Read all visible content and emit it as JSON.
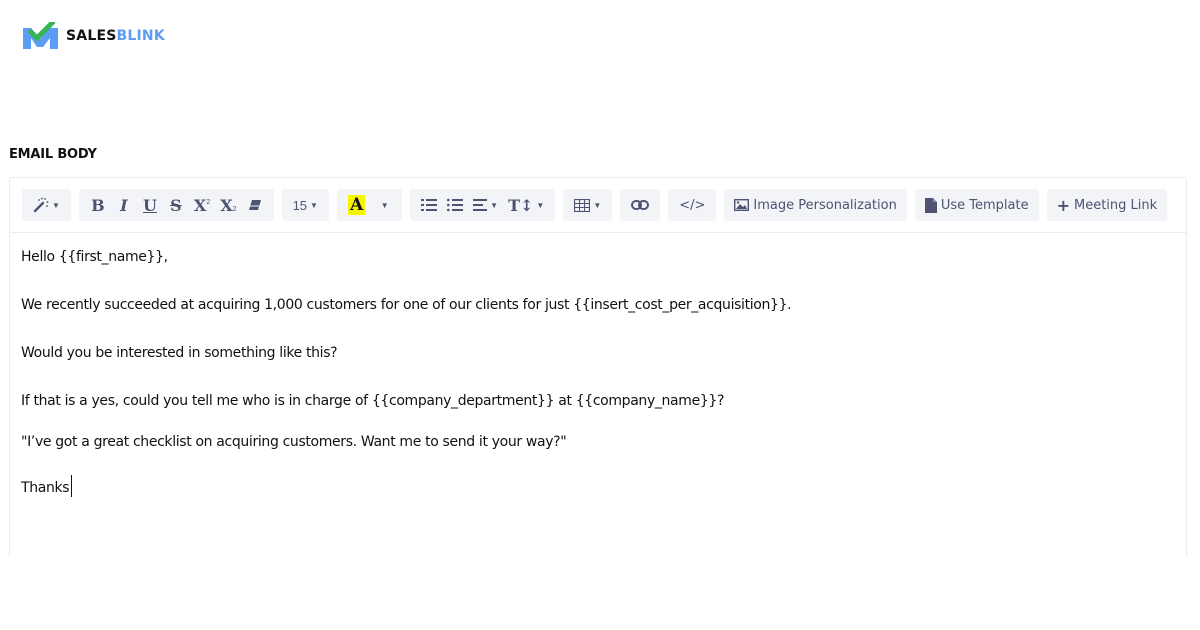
{
  "brand": {
    "name_part1": "SALES",
    "name_part2": "BLINK",
    "accent_color": "#5b9cf5",
    "check_color": "#36b555"
  },
  "section": {
    "title": "EMAIL BODY"
  },
  "toolbar": {
    "magic_icon": "magic-wand-icon",
    "bold": "B",
    "italic": "I",
    "underline": "U",
    "strikethrough": "S",
    "superscript": "X",
    "superscript_mark": "2",
    "subscript": "X",
    "subscript_mark": "2",
    "font_size": "15",
    "highlight_letter": "A",
    "highlight_color": "#f5f500",
    "text_height": "T↕",
    "code": "</>",
    "image_personalization": "Image Personalization",
    "use_template": "Use Template",
    "meeting_link": "Meeting Link",
    "plus": "+"
  },
  "body": {
    "lines": [
      "Hello {{first_name}},",
      "We recently succeeded at acquiring 1,000 customers for one of our clients for just {{insert_cost_per_acquisition}}.",
      "Would you be interested in something like this?",
      "If that is a yes, could you tell me who is in charge of {{company_department}} at {{company_name}}?",
      "\"I’ve got a great checklist on acquiring customers. Want me to send it your way?\"",
      "Thanks"
    ]
  }
}
